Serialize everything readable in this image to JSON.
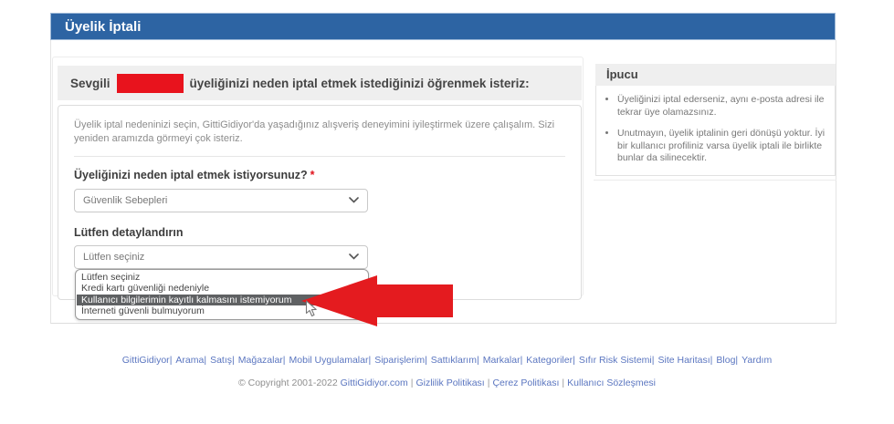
{
  "page": {
    "title_bar": "Üyelik İptali"
  },
  "main": {
    "greeting": {
      "prefix": "Sevgili",
      "suffix": "üyeliğinizi neden iptal etmek istediğinizi öğrenmek isteriz:"
    },
    "description": "Üyelik iptal nedeninizi seçin, GittiGidiyor'da yaşadığınız alışveriş deneyimini iyileştirmek üzere çalışalım. Sizi yeniden aramızda görmeyi çok isteriz.",
    "question1": {
      "label": "Üyeliğinizi neden iptal etmek istiyorsunuz?",
      "required_mark": "*",
      "selected": "Güvenlik Sebepleri"
    },
    "question2": {
      "label": "Lütfen detaylandırın",
      "selected": "Lütfen seçiniz",
      "options": [
        "Lütfen seçiniz",
        "Kredi kartı güvenliği nedeniyle",
        "Kullanıcı bilgilerimin kayıtlı kalmasını istemiyorum",
        "İnterneti güvenli bulmuyorum"
      ],
      "highlighted_index": 2
    }
  },
  "sidebar": {
    "title": "İpucu",
    "tips": [
      "Üyeliğinizi iptal ederseniz, aynı e-posta adresi ile tekrar üye olamazsınız.",
      "Unutmayın, üyelik iptalinin geri dönüşü yoktur. İyi bir kullanıcı profiliniz varsa üyelik iptali ile birlikte bunlar da silinecektir."
    ]
  },
  "footer": {
    "links": [
      "GittiGidiyor",
      "Arama",
      "Satış",
      "Mağazalar",
      "Mobil Uygulamalar",
      "Siparişlerim",
      "Sattıklarım",
      "Markalar",
      "Kategoriler",
      "Sıfır Risk Sistemi",
      "Site Haritası",
      "Blog",
      "Yardım"
    ],
    "separator": "|",
    "copyright_prefix": "© Copyright 2001-2022",
    "copyright_links": [
      "GittiGidiyor.com",
      "Gizlilik Politikası",
      "Çerez Politikası",
      "Kullanıcı Sözleşmesi"
    ],
    "copyright_separator": "|"
  },
  "colors": {
    "header_blue": "#2d64a3",
    "strip_gray": "#efefef",
    "highlight_gray": "#5f6163",
    "arrow_red": "#e41b1f",
    "link_blue": "#5b76c0",
    "redaction_red": "#e8131d"
  }
}
